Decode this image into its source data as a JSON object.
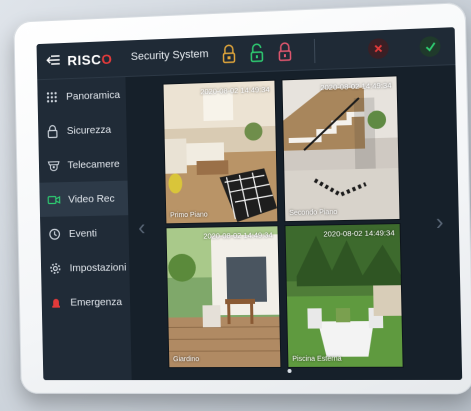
{
  "app": {
    "logo": "RISC",
    "logo_o": "O",
    "title": "Security System"
  },
  "sidebar": {
    "items": [
      {
        "label": "Panoramica",
        "icon": "grid-icon"
      },
      {
        "label": "Sicurezza",
        "icon": "lock-icon"
      },
      {
        "label": "Telecamere",
        "icon": "camera-icon"
      },
      {
        "label": "Video Rec",
        "icon": "video-icon",
        "active": true
      },
      {
        "label": "Eventi",
        "icon": "history-icon"
      },
      {
        "label": "Impostazioni",
        "icon": "gear-icon"
      },
      {
        "label": "Emergenza",
        "icon": "alarm-icon"
      }
    ]
  },
  "cameras": [
    {
      "timestamp": "2020-08-02 14:49:34",
      "caption": "Primo Piano"
    },
    {
      "timestamp": "2020-08-02 14:49:34",
      "caption": "Secondo Piano"
    },
    {
      "timestamp": "2020-08-02 14:49:34",
      "caption": "Giardino"
    },
    {
      "timestamp": "2020-08-02 14:49:34",
      "caption": "Piscina Esterna"
    }
  ],
  "colors": {
    "lock_partial": "#e0a53a",
    "lock_open": "#2ecc71",
    "lock_alarm": "#e0566e",
    "cancel": "#e23a3a",
    "confirm": "#2ecc71",
    "accent": "#e23a3a"
  }
}
